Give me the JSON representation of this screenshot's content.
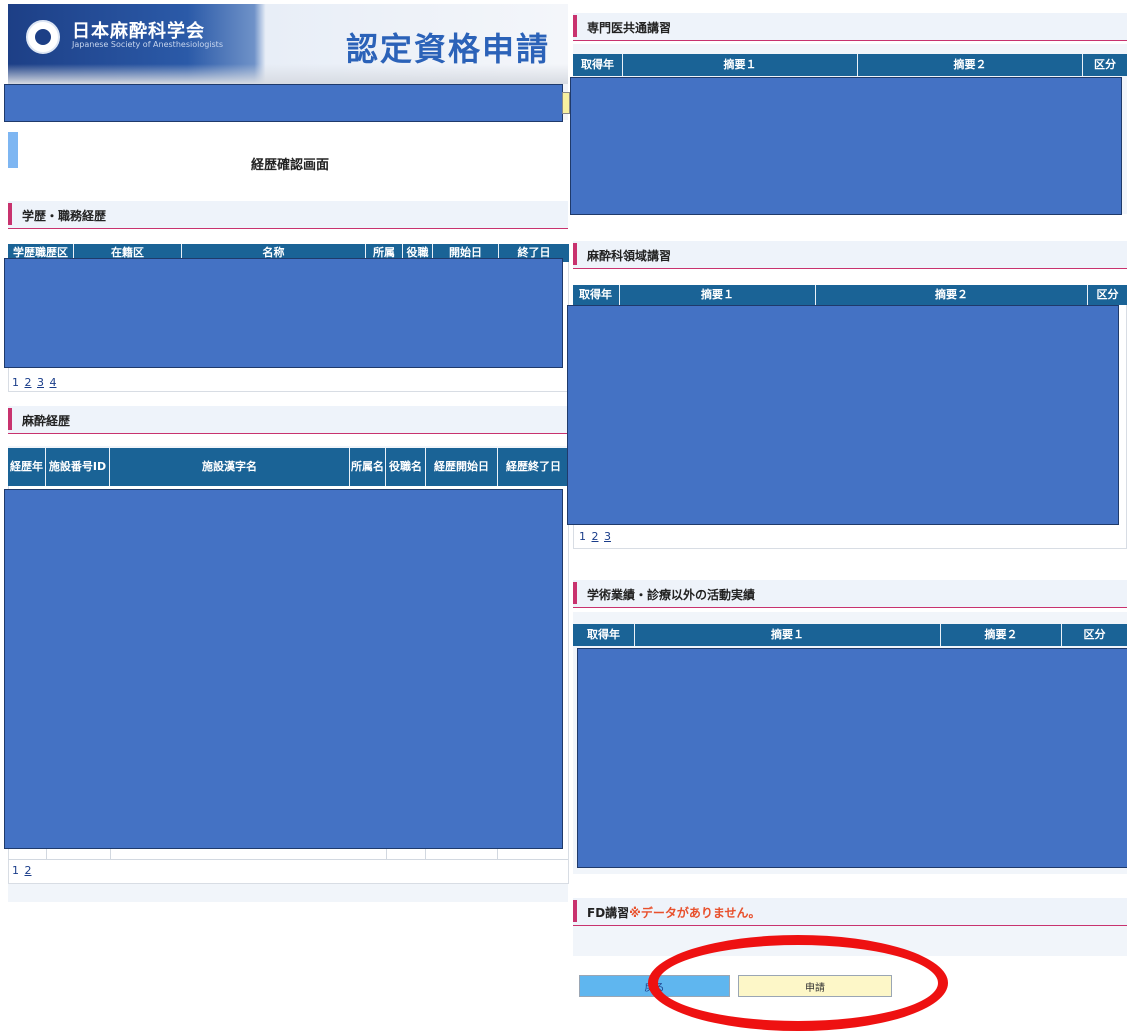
{
  "header": {
    "logo_text": "日本麻酔科学会",
    "logo_sub": "Japanese Society of Anesthesiologists",
    "app_title": "認定資格申請"
  },
  "page": {
    "title": "経歴確認画面"
  },
  "sections": {
    "academic": {
      "title": "学歴・職務経歴",
      "columns": [
        "学歴職歴区",
        "在籍区",
        "名称",
        "所属",
        "役職",
        "開始日",
        "終了日"
      ],
      "pages": [
        "1",
        "2",
        "3",
        "4"
      ]
    },
    "anesthesia": {
      "title": "麻酔経歴",
      "columns": [
        "経歴年",
        "施設番号ID",
        "施設漢字名",
        "所属名",
        "役職名",
        "経歴開始日",
        "経歴終了日"
      ],
      "pages": [
        "1",
        "2"
      ]
    },
    "common_course": {
      "title": "専門医共通講習",
      "columns": [
        "取得年",
        "摘要１",
        "摘要２",
        "区分"
      ]
    },
    "field_course": {
      "title": "麻酔科領域講習",
      "columns": [
        "取得年",
        "摘要１",
        "摘要２",
        "区分"
      ],
      "pages": [
        "1",
        "2",
        "3"
      ]
    },
    "activities": {
      "title": "学術業績・診療以外の活動実績",
      "columns": [
        "取得年",
        "摘要１",
        "摘要２",
        "区分"
      ]
    },
    "fd": {
      "title": "FD講習",
      "note": "※データがありません。"
    }
  },
  "buttons": {
    "back": "戻る",
    "apply": "申請"
  },
  "colors": {
    "table_header": "#1a6396",
    "section_accent": "#c8326e",
    "redaction": "#4472c4",
    "highlight": "#ee1111",
    "back_button": "#5fb6ef",
    "apply_button": "#fdf7c8"
  }
}
